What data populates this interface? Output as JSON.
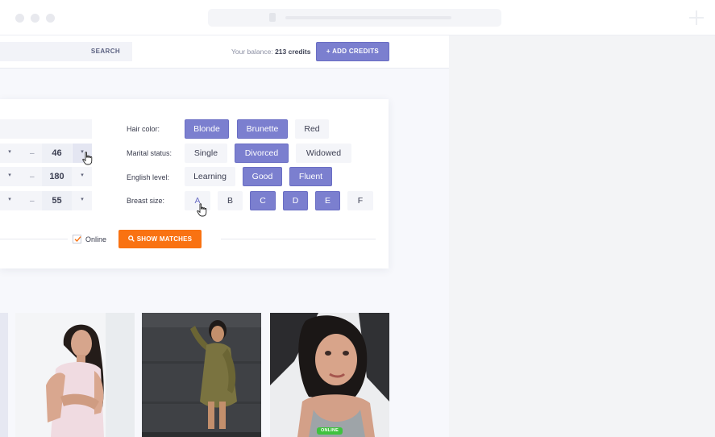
{
  "search": {
    "button_label": "SEARCH"
  },
  "balance": {
    "prefix": "Your balance:",
    "amount": "213 credits"
  },
  "add_credits_label": "+ ADD CREDITS",
  "ranges": [
    {
      "max": "46"
    },
    {
      "max": "180"
    },
    {
      "max": "55"
    }
  ],
  "range_separator": "–",
  "filters": {
    "hair_color": {
      "label": "Hair color:",
      "options": [
        {
          "label": "Blonde",
          "selected": true
        },
        {
          "label": "Brunette",
          "selected": true
        },
        {
          "label": "Red",
          "selected": false
        }
      ]
    },
    "marital_status": {
      "label": "Marital status:",
      "options": [
        {
          "label": "Single",
          "selected": false
        },
        {
          "label": "Divorced",
          "selected": true
        },
        {
          "label": "Widowed",
          "selected": false
        }
      ]
    },
    "english_level": {
      "label": "English level:",
      "options": [
        {
          "label": "Learning",
          "selected": false
        },
        {
          "label": "Good",
          "selected": true
        },
        {
          "label": "Fluent",
          "selected": true
        }
      ]
    },
    "breast_size": {
      "label": "Breast size:",
      "options": [
        {
          "label": "A",
          "selected": false
        },
        {
          "label": "B",
          "selected": false
        },
        {
          "label": "C",
          "selected": true
        },
        {
          "label": "D",
          "selected": true
        },
        {
          "label": "E",
          "selected": true
        },
        {
          "label": "F",
          "selected": false
        }
      ]
    }
  },
  "online_filter": {
    "label": "Online",
    "checked": true
  },
  "show_matches_label": "SHOW MATCHES",
  "profiles": [
    {
      "online": false
    },
    {
      "online": false
    },
    {
      "online": true,
      "badge": "ONLINE"
    }
  ],
  "colors": {
    "accent": "#7b7fcf",
    "cta": "#f97212",
    "online": "#3fc23f"
  }
}
